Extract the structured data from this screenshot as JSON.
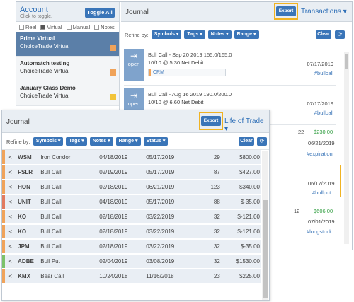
{
  "account": {
    "title": "Account",
    "subtitle": "Click to toggle.",
    "toggle_all": "Toggle All",
    "filters": [
      {
        "label": "Real",
        "checked": false
      },
      {
        "label": "Virtual",
        "checked": true
      },
      {
        "label": "Manual",
        "checked": false
      },
      {
        "label": "Notes",
        "checked": false
      }
    ],
    "items": [
      {
        "name": "Prime Virtual",
        "type": "ChoiceTrade Virtual",
        "selected": true,
        "color": "#f0a35a"
      },
      {
        "name": "Automatch testing",
        "type": "ChoiceTrade Virtual",
        "selected": false,
        "color": "#f0a35a"
      },
      {
        "name": "January Class Demo",
        "type": "ChoiceTrade Virtual",
        "selected": false,
        "color": "#f2c43a"
      }
    ]
  },
  "journal_bg": {
    "title": "Journal",
    "export": "Export",
    "view": "Transactions",
    "refine_label": "Refine by:",
    "refine_buttons": [
      "Symbols",
      "Tags",
      "Notes",
      "Range"
    ],
    "clear": "Clear",
    "entries": [
      {
        "open": "open",
        "line1": "Bull Call - Sep 20 2019 155.0/165.0",
        "line2": "10/10 @ 5.30 Net Debit",
        "date": "07/17/2019",
        "symbol": "CRM",
        "tag": "#bullcall"
      },
      {
        "open": "open",
        "line1": "Bull Call - Aug 16 2019 190.0/200.0",
        "line2": "10/10 @ 6.60 Net Debit",
        "date": "07/17/2019",
        "tag": "#bullcall"
      }
    ],
    "right_peek": [
      {
        "a": "22",
        "b": "$230.00"
      },
      {
        "a": "",
        "b": "06/21/2019"
      },
      {
        "a": "",
        "b": "#expiration"
      },
      {
        "a": "",
        "b": "06/17/2019"
      },
      {
        "a": "",
        "b": "#bullput"
      },
      {
        "a": "12",
        "b": "$606.00"
      },
      {
        "a": "",
        "b": "07/01/2019"
      },
      {
        "a": "",
        "b": "#longstock"
      }
    ]
  },
  "journal_fg": {
    "title": "Journal",
    "export": "Export",
    "view": "Life of Trade",
    "refine_label": "Refine by:",
    "refine_buttons": [
      "Symbols",
      "Tags",
      "Notes",
      "Range",
      "Status"
    ],
    "clear": "Clear",
    "trades": [
      {
        "symbol": "WSM",
        "strategy": "Iron Condor",
        "opened": "04/18/2019",
        "closed": "05/17/2019",
        "days": "29",
        "pl": "$800.00",
        "positive": true,
        "stripe": "#f0a35a"
      },
      {
        "symbol": "FSLR",
        "strategy": "Bull Call",
        "opened": "02/19/2019",
        "closed": "05/17/2019",
        "days": "87",
        "pl": "$427.00",
        "positive": true,
        "stripe": "#f0a35a"
      },
      {
        "symbol": "HON",
        "strategy": "Bull Call",
        "opened": "02/18/2019",
        "closed": "06/21/2019",
        "days": "123",
        "pl": "$340.00",
        "positive": true,
        "stripe": "#f0a35a"
      },
      {
        "symbol": "UNIT",
        "strategy": "Bull Call",
        "opened": "04/18/2019",
        "closed": "05/17/2019",
        "days": "88",
        "pl": "$-35.00",
        "positive": false,
        "stripe": "#e27a5f"
      },
      {
        "symbol": "KO",
        "strategy": "Bull Call",
        "opened": "02/18/2019",
        "closed": "03/22/2019",
        "days": "32",
        "pl": "$-121.00",
        "positive": false,
        "stripe": "#f0a35a"
      },
      {
        "symbol": "KO",
        "strategy": "Bull Call",
        "opened": "02/18/2019",
        "closed": "03/22/2019",
        "days": "32",
        "pl": "$-121.00",
        "positive": false,
        "stripe": "#f0a35a"
      },
      {
        "symbol": "JPM",
        "strategy": "Bull Call",
        "opened": "02/18/2019",
        "closed": "03/22/2019",
        "days": "32",
        "pl": "$-35.00",
        "positive": false,
        "stripe": "#f0a35a"
      },
      {
        "symbol": "ADBE",
        "strategy": "Bull Put",
        "opened": "02/04/2019",
        "closed": "03/08/2019",
        "days": "32",
        "pl": "$1530.00",
        "positive": true,
        "stripe": "#7cc26a"
      },
      {
        "symbol": "KMX",
        "strategy": "Bear Call",
        "opened": "10/24/2018",
        "closed": "11/16/2018",
        "days": "23",
        "pl": "$225.00",
        "positive": true,
        "stripe": "#f0a35a"
      }
    ]
  },
  "colors": {
    "accent": "#3a75b8",
    "highlight": "#f0b323",
    "positive": "#2e9d3e",
    "negative": "#d0453a"
  },
  "icons": {
    "share": "share-icon",
    "open": "open-arrow-icon",
    "refresh": "refresh-icon",
    "caret": "caret-down-icon"
  }
}
